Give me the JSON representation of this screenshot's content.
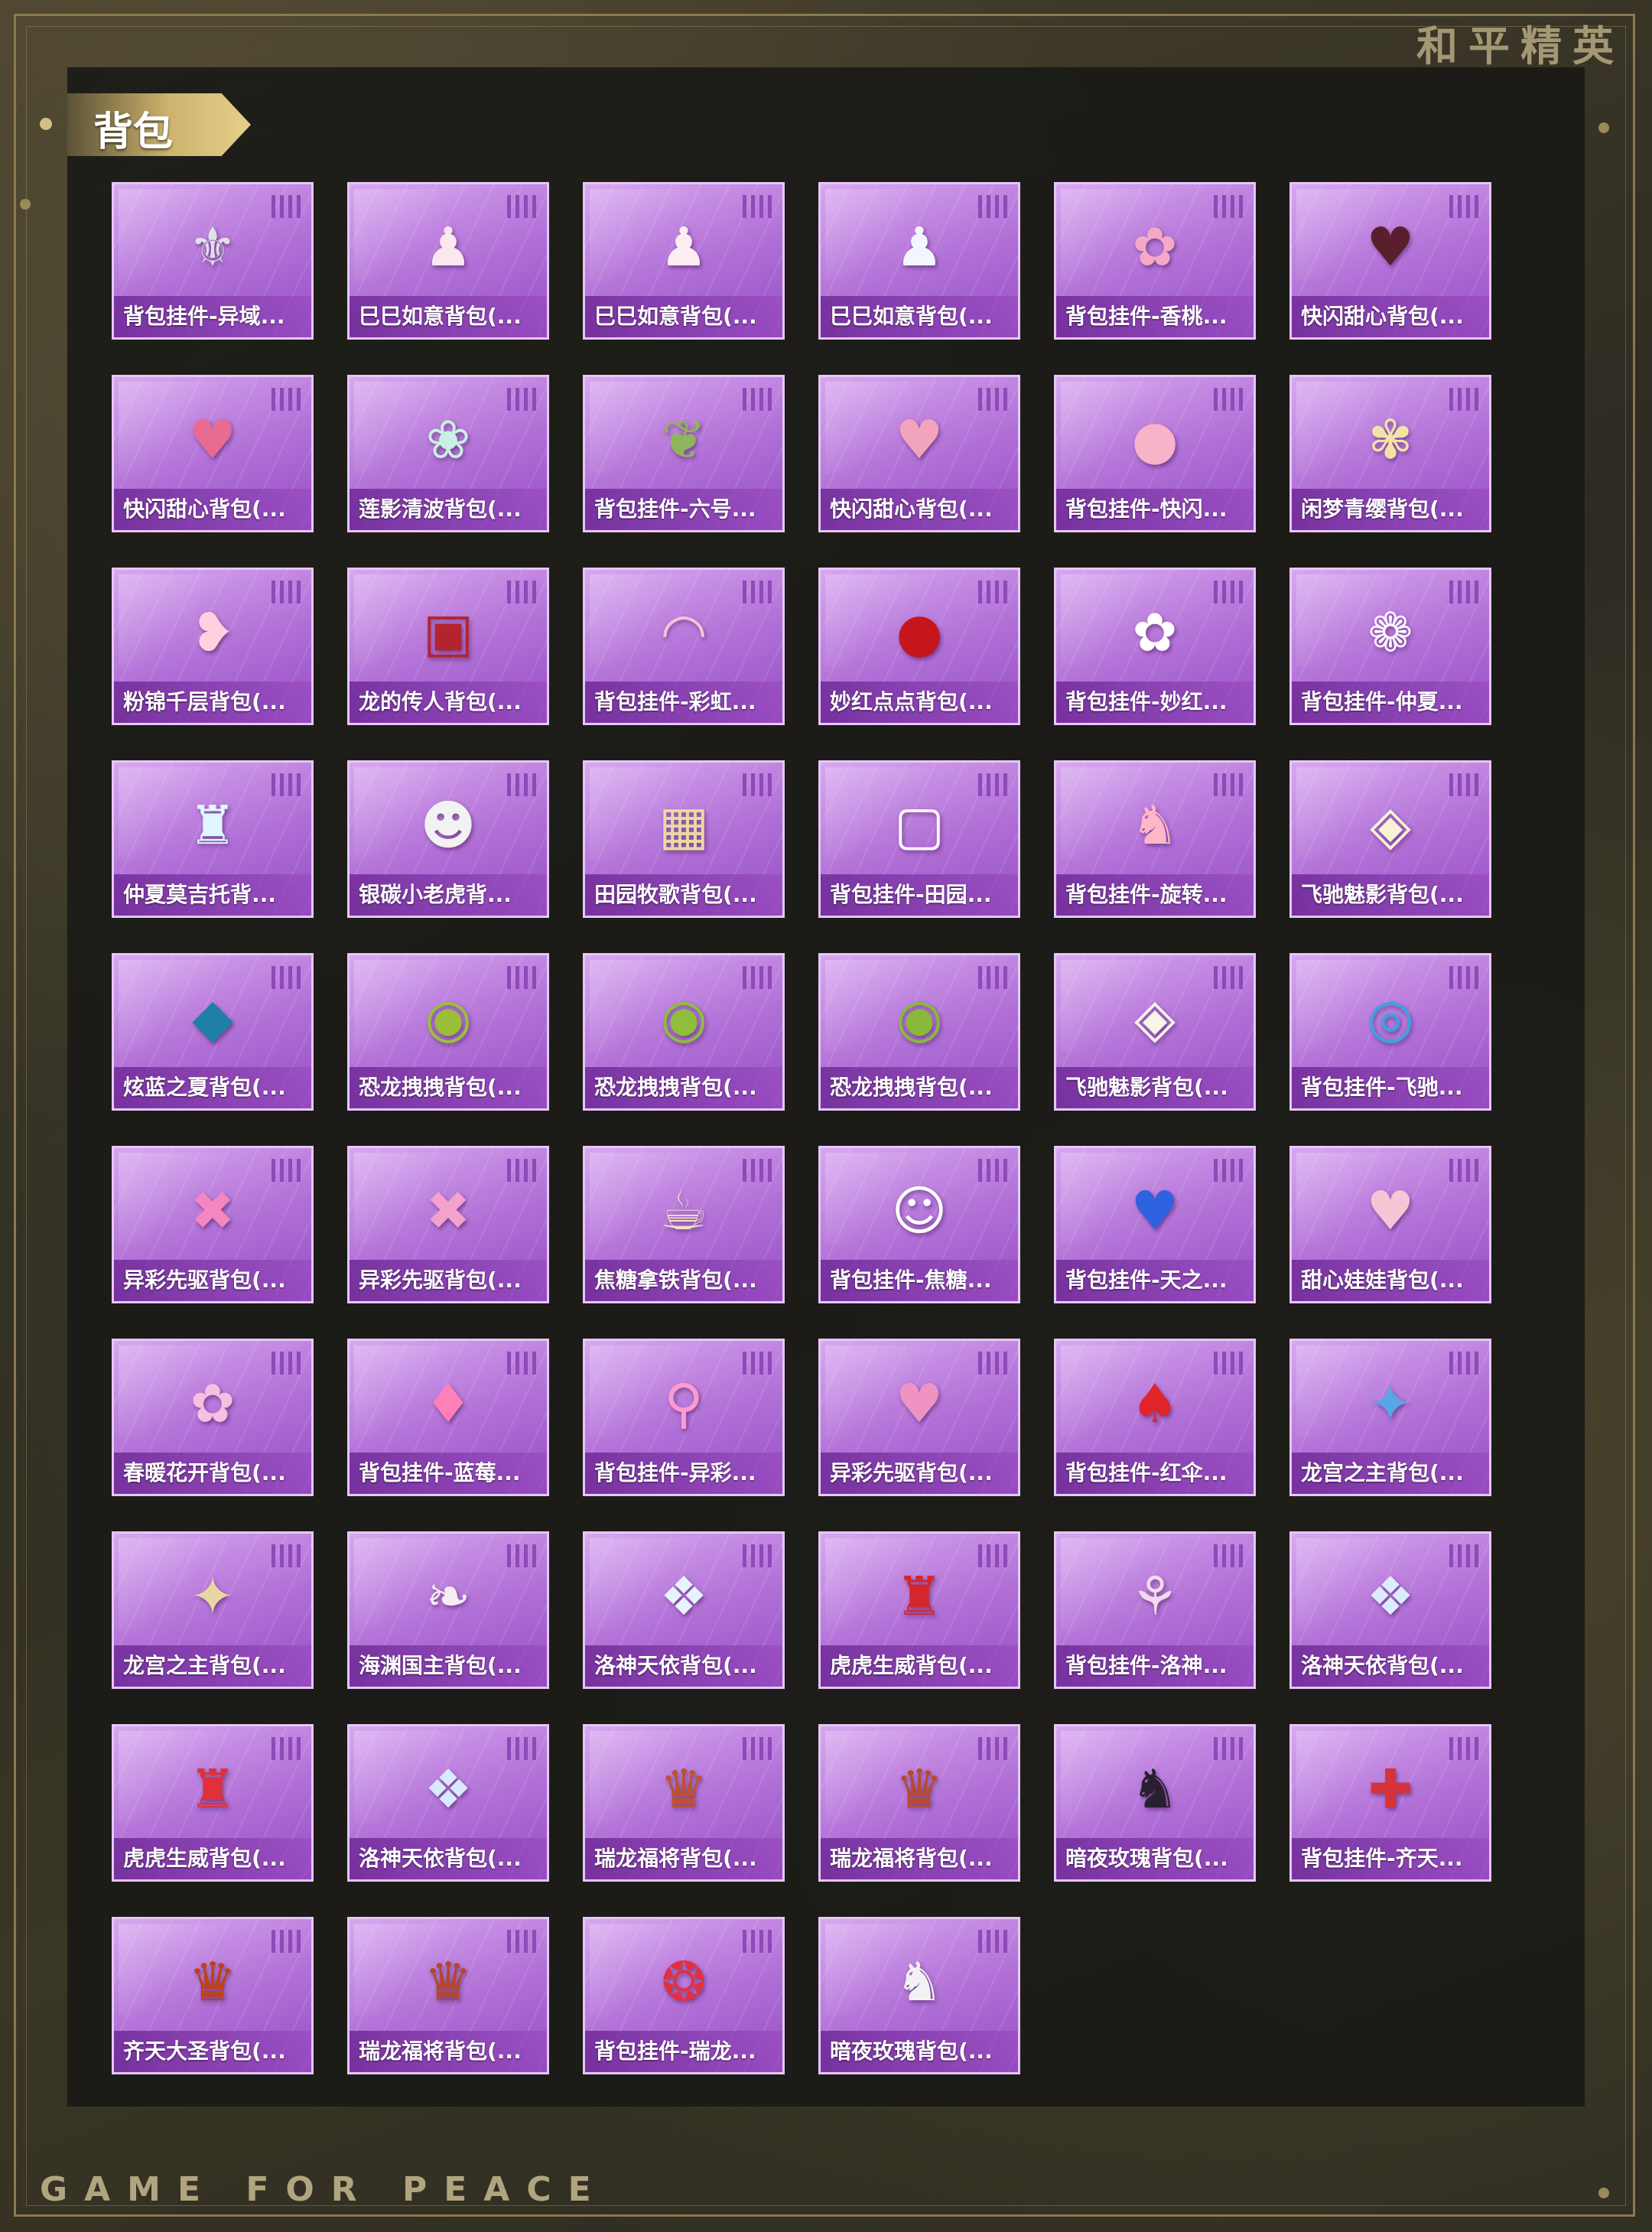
{
  "brand": {
    "top": "和平精英",
    "bottom": "GAME FOR PEACE"
  },
  "section": {
    "title": "背包"
  },
  "items": [
    {
      "name": "背包挂件-异域...",
      "icon": "pendant-icon",
      "glyph": "⚜",
      "color": "#e0e0e8"
    },
    {
      "name": "巳巳如意背包(...",
      "icon": "backpack-icon",
      "glyph": "♟",
      "color": "#fbe7ef"
    },
    {
      "name": "巳巳如意背包(...",
      "icon": "backpack-icon",
      "glyph": "♟",
      "color": "#fdeef4"
    },
    {
      "name": "巳巳如意背包(...",
      "icon": "backpack-icon",
      "glyph": "♟",
      "color": "#f4f6ff"
    },
    {
      "name": "背包挂件-香桃...",
      "icon": "pendant-icon",
      "glyph": "✿",
      "color": "#f6a9c7"
    },
    {
      "name": "快闪甜心背包(...",
      "icon": "backpack-icon",
      "glyph": "♥",
      "color": "#5a1f2d"
    },
    {
      "name": "快闪甜心背包(...",
      "icon": "backpack-icon",
      "glyph": "♥",
      "color": "#e86b92"
    },
    {
      "name": "莲影清波背包(...",
      "icon": "backpack-icon",
      "glyph": "❀",
      "color": "#c9f0e3"
    },
    {
      "name": "背包挂件-六号...",
      "icon": "pendant-icon",
      "glyph": "❦",
      "color": "#8fb45a"
    },
    {
      "name": "快闪甜心背包(...",
      "icon": "backpack-icon",
      "glyph": "♥",
      "color": "#f2a4bd"
    },
    {
      "name": "背包挂件-快闪...",
      "icon": "pendant-icon",
      "glyph": "●",
      "color": "#f7b4c9"
    },
    {
      "name": "闲梦青缨背包(...",
      "icon": "backpack-icon",
      "glyph": "✾",
      "color": "#f3e2a6"
    },
    {
      "name": "粉锦千层背包(...",
      "icon": "backpack-icon",
      "glyph": "❥",
      "color": "#ffd1df"
    },
    {
      "name": "龙的传人背包(...",
      "icon": "backpack-icon",
      "glyph": "▣",
      "color": "#b3242e"
    },
    {
      "name": "背包挂件-彩虹...",
      "icon": "pendant-icon",
      "glyph": "◠",
      "color": "#f6c2d8"
    },
    {
      "name": "妙红点点背包(...",
      "icon": "backpack-icon",
      "glyph": "●",
      "color": "#c4161c"
    },
    {
      "name": "背包挂件-妙红...",
      "icon": "pendant-icon",
      "glyph": "✿",
      "color": "#ffffff"
    },
    {
      "name": "背包挂件-仲夏...",
      "icon": "pendant-icon",
      "glyph": "❁",
      "color": "#fbf3ff"
    },
    {
      "name": "仲夏莫吉托背...",
      "icon": "backpack-icon",
      "glyph": "♜",
      "color": "#dff6ff"
    },
    {
      "name": "银碳小老虎背...",
      "icon": "backpack-icon",
      "glyph": "☻",
      "color": "#f2f2f2"
    },
    {
      "name": "田园牧歌背包(...",
      "icon": "backpack-icon",
      "glyph": "▦",
      "color": "#e9d9a4"
    },
    {
      "name": "背包挂件-田园...",
      "icon": "pendant-icon",
      "glyph": "▢",
      "color": "#fff4f8"
    },
    {
      "name": "背包挂件-旋转...",
      "icon": "pendant-icon",
      "glyph": "♞",
      "color": "#ffb6c9"
    },
    {
      "name": "飞驰魅影背包(...",
      "icon": "backpack-icon",
      "glyph": "◈",
      "color": "#f7f2d6"
    },
    {
      "name": "炫蓝之夏背包(...",
      "icon": "backpack-icon",
      "glyph": "◆",
      "color": "#1f7fa6"
    },
    {
      "name": "恐龙拽拽背包(...",
      "icon": "backpack-icon",
      "glyph": "◉",
      "color": "#9cbf3a"
    },
    {
      "name": "恐龙拽拽背包(...",
      "icon": "backpack-icon",
      "glyph": "◉",
      "color": "#8fbd3c"
    },
    {
      "name": "恐龙拽拽背包(...",
      "icon": "backpack-icon",
      "glyph": "◉",
      "color": "#8ab83a"
    },
    {
      "name": "飞驰魅影背包(...",
      "icon": "backpack-icon",
      "glyph": "◈",
      "color": "#f7f4e8"
    },
    {
      "name": "背包挂件-飞驰...",
      "icon": "pendant-icon",
      "glyph": "◎",
      "color": "#3aa3e3"
    },
    {
      "name": "异彩先驱背包(...",
      "icon": "backpack-icon",
      "glyph": "✖",
      "color": "#f486c0"
    },
    {
      "name": "异彩先驱背包(...",
      "icon": "backpack-icon",
      "glyph": "✖",
      "color": "#f3a2cc"
    },
    {
      "name": "焦糖拿铁背包(...",
      "icon": "backpack-icon",
      "glyph": "☕",
      "color": "#f5e3c4"
    },
    {
      "name": "背包挂件-焦糖...",
      "icon": "pendant-icon",
      "glyph": "☺",
      "color": "#ffffff"
    },
    {
      "name": "背包挂件-天之...",
      "icon": "pendant-icon",
      "glyph": "♥",
      "color": "#2e62e0"
    },
    {
      "name": "甜心娃娃背包(...",
      "icon": "backpack-icon",
      "glyph": "♥",
      "color": "#f6c5d6"
    },
    {
      "name": "春暖花开背包(...",
      "icon": "backpack-icon",
      "glyph": "✿",
      "color": "#f7bfe0"
    },
    {
      "name": "背包挂件-蓝莓...",
      "icon": "pendant-icon",
      "glyph": "♦",
      "color": "#ff80b8"
    },
    {
      "name": "背包挂件-异彩...",
      "icon": "pendant-icon",
      "glyph": "⚲",
      "color": "#ff9ad0"
    },
    {
      "name": "异彩先驱背包(...",
      "icon": "backpack-icon",
      "glyph": "♥",
      "color": "#ef93c2"
    },
    {
      "name": "背包挂件-红伞...",
      "icon": "pendant-icon",
      "glyph": "♠",
      "color": "#e0242a"
    },
    {
      "name": "龙宫之主背包(...",
      "icon": "backpack-icon",
      "glyph": "✦",
      "color": "#5aa4e8"
    },
    {
      "name": "龙宫之主背包(...",
      "icon": "backpack-icon",
      "glyph": "✦",
      "color": "#e8d7a2"
    },
    {
      "name": "海渊国主背包(...",
      "icon": "backpack-icon",
      "glyph": "❧",
      "color": "#f6ecf1"
    },
    {
      "name": "洛神天依背包(...",
      "icon": "backpack-icon",
      "glyph": "❖",
      "color": "#e7f2ff"
    },
    {
      "name": "虎虎生威背包(...",
      "icon": "backpack-icon",
      "glyph": "♜",
      "color": "#d5262b"
    },
    {
      "name": "背包挂件-洛神...",
      "icon": "pendant-icon",
      "glyph": "⚘",
      "color": "#f2d9f0"
    },
    {
      "name": "洛神天依背包(...",
      "icon": "backpack-icon",
      "glyph": "❖",
      "color": "#dcecff"
    },
    {
      "name": "虎虎生威背包(...",
      "icon": "backpack-icon",
      "glyph": "♜",
      "color": "#e0303a"
    },
    {
      "name": "洛神天依背包(...",
      "icon": "backpack-icon",
      "glyph": "❖",
      "color": "#d7eaff"
    },
    {
      "name": "瑞龙福将背包(...",
      "icon": "backpack-icon",
      "glyph": "♛",
      "color": "#c0512c"
    },
    {
      "name": "瑞龙福将背包(...",
      "icon": "backpack-icon",
      "glyph": "♛",
      "color": "#b84a2e"
    },
    {
      "name": "暗夜玫瑰背包(...",
      "icon": "backpack-icon",
      "glyph": "♞",
      "color": "#2a1f30"
    },
    {
      "name": "背包挂件-齐天...",
      "icon": "pendant-icon",
      "glyph": "✚",
      "color": "#d6323a"
    },
    {
      "name": "齐天大圣背包(...",
      "icon": "backpack-icon",
      "glyph": "♛",
      "color": "#c04018"
    },
    {
      "name": "瑞龙福将背包(...",
      "icon": "backpack-icon",
      "glyph": "♛",
      "color": "#b5462a"
    },
    {
      "name": "背包挂件-瑞龙...",
      "icon": "pendant-icon",
      "glyph": "❂",
      "color": "#e23040"
    },
    {
      "name": "暗夜玫瑰背包(...",
      "icon": "backpack-icon",
      "glyph": "♞",
      "color": "#f2f2f2"
    }
  ]
}
